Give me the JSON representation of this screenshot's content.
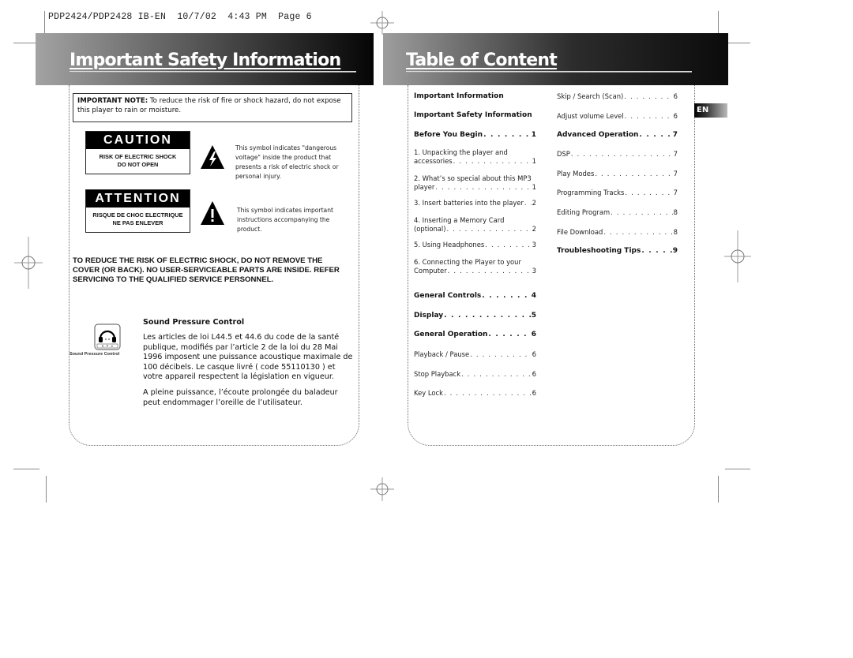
{
  "slug": "PDP2424/PDP2428 IB-EN  10/7/02  4:43 PM  Page 6",
  "left_page": {
    "title": "Important Safety Information",
    "note": {
      "label": "IMPORTANT NOTE:",
      "text": " To reduce the risk of fire or shock hazard, do not expose this player to rain or moisture."
    },
    "caution": {
      "heading": "CAUTION",
      "line1": "RISK OF ELECTRIC SHOCK",
      "line2": "DO NOT OPEN",
      "symbol_icon": "lightning-triangle-icon",
      "symbol_text": "This symbol indicates \"dangerous voltage\" inside the product that presents a risk of electric shock or personal injury."
    },
    "attention": {
      "heading": "ATTENTION",
      "line1": "RISQUE DE CHOC ELECTRIQUE",
      "line2": "NE PAS ENLEVER",
      "symbol_icon": "exclamation-triangle-icon",
      "symbol_text": "This symbol indicates important instructions accompanying the product."
    },
    "warning": "TO REDUCE THE RISK OF ELECTRIC SHOCK, DO NOT REMOVE THE COVER (OR BACK). NO USER-SERVICEABLE PARTS ARE INSIDE. REFER SERVICING TO THE QUALIFIED SERVICE PERSONNEL.",
    "spc": {
      "icon": "headphones-icon",
      "badge": "S.P.C",
      "caption": "Sound Pressure Control",
      "title": "Sound Pressure Control",
      "para1": "Les articles de loi L44.5 et 44.6 du code de la santé publique, modifiés par l’article 2 de la loi du 28 Mai 1996 imposent une puissance acoustique maximale de 100 décibels. Le casque livré ( code 55110130 ) et votre appareil respectent la législation en vigueur.",
      "para2": "A pleine puissance, l’écoute prolongée du baladeur peut endommager l’oreille de l’utilisateur."
    }
  },
  "right_page": {
    "title": "Table of Content",
    "lang_tab": "EN",
    "col1": [
      {
        "label": "Important Information",
        "page": "",
        "bold": true
      },
      {
        "label": "Important Safety Information",
        "page": "",
        "bold": true
      },
      {
        "label": "Before You Begin",
        "page": "1",
        "bold": true
      },
      {
        "label1": "1.  Unpacking the player and",
        "label": "accessories",
        "page": "1",
        "bold": false
      },
      {
        "label1": "2.  What’s so special about this MP3",
        "label": "player",
        "page": "1",
        "bold": false
      },
      {
        "label": "3.  Insert batteries into the player",
        "page": "2",
        "bold": false
      },
      {
        "label1": "4.  Inserting a Memory Card",
        "label": "(optional)",
        "page": "2",
        "bold": false
      },
      {
        "label": "5.   Using Headphones",
        "page": "3",
        "bold": false
      },
      {
        "label1": "6.   Connecting the Player to your",
        "label": "Computer",
        "page": "3",
        "bold": false
      },
      {
        "label": "General Controls",
        "page": "4",
        "bold": true
      },
      {
        "label": "Display",
        "page": "5",
        "bold": true
      },
      {
        "label": "General Operation",
        "page": "6",
        "bold": true
      },
      {
        "label": "Playback / Pause",
        "page": "6",
        "bold": false
      },
      {
        "label": "Stop Playback",
        "page": "6",
        "bold": false
      },
      {
        "label": "Key Lock",
        "page": "6",
        "bold": false
      }
    ],
    "col2": [
      {
        "label": "Skip / Search (Scan)",
        "page": "6",
        "bold": false
      },
      {
        "label": "Adjust volume Level",
        "page": "6",
        "bold": false
      },
      {
        "label": "Advanced Operation",
        "page": "7",
        "bold": true
      },
      {
        "label": "DSP",
        "page": "7",
        "bold": false
      },
      {
        "label": "Play Modes",
        "page": "7",
        "bold": false
      },
      {
        "label": "Programming Tracks",
        "page": "7",
        "bold": false
      },
      {
        "label": "Editing Program",
        "page": "8",
        "bold": false
      },
      {
        "label": "File Download",
        "page": "8",
        "bold": false
      },
      {
        "label": "Troubleshooting Tips",
        "page": "9",
        "bold": true
      }
    ]
  }
}
